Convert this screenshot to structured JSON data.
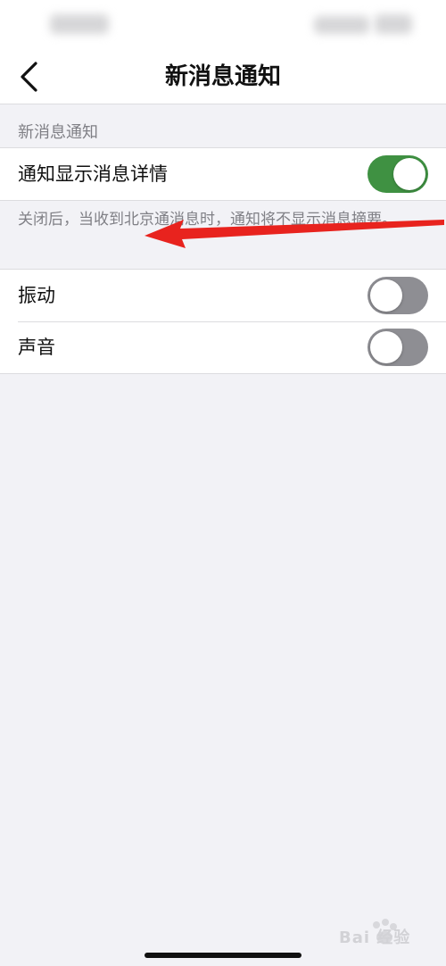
{
  "nav": {
    "title": "新消息通知"
  },
  "section": {
    "header": "新消息通知"
  },
  "rows": [
    {
      "label": "通知显示消息详情",
      "toggle": "on"
    },
    {
      "label": "振动",
      "toggle": "off"
    },
    {
      "label": "声音",
      "toggle": "off"
    }
  ],
  "description": "关闭后，当收到北京通消息时，通知将不显示消息摘要。",
  "watermark": {
    "text": "Bai 经验"
  },
  "colors": {
    "toggle_on": "#3f9142",
    "toggle_off": "#8e8e93",
    "annotation_arrow": "#e8231e",
    "background": "#f2f2f6"
  },
  "icons": {
    "back": "chevron-left-icon",
    "arrow": "red-arrow-annotation"
  }
}
